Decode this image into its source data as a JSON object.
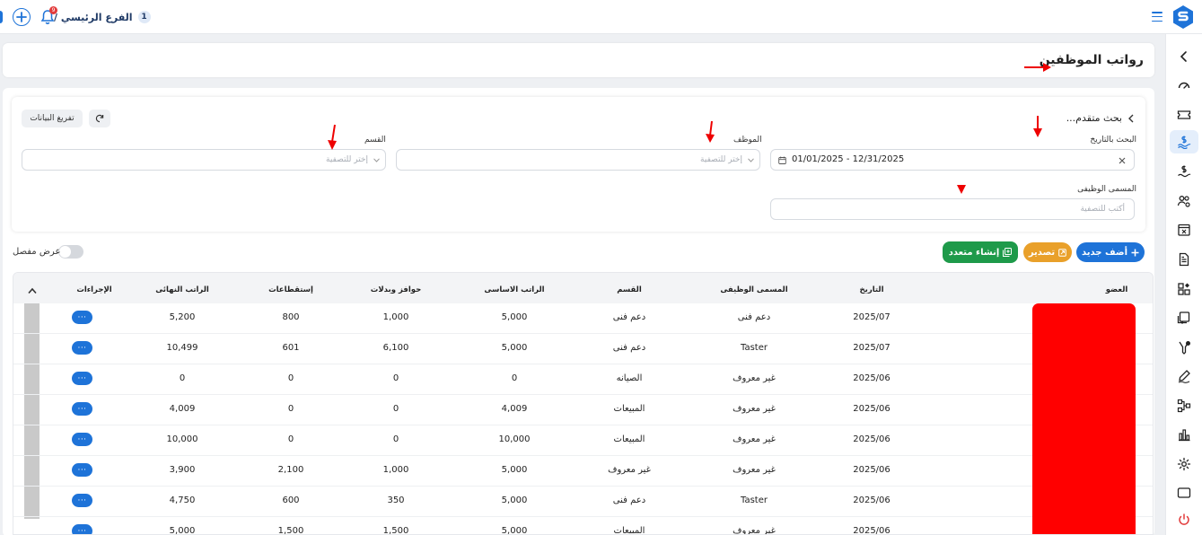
{
  "topbar": {
    "branch_label": "الفرع الرئيسي /",
    "branch_number": "1",
    "notification_count": "9"
  },
  "page": {
    "title": "رواتب الموظفين"
  },
  "filters": {
    "advanced_search_label": "بحث متقدم...",
    "clear_button": "تفريغ البيانات",
    "date_label": "البحث بالتاريخ",
    "date_value": "01/01/2025 - 12/31/2025",
    "employee_label": "الموظف",
    "employee_placeholder": "إختر للتصفية",
    "department_label": "القسم",
    "department_placeholder": "إختر للتصفية",
    "job_title_label": "المسمى الوظيفى",
    "job_title_placeholder": "أكتب للتصفية"
  },
  "actions": {
    "add_new": "أضف جديد",
    "export": "تصدير",
    "bulk_create": "إنشاء متعدد",
    "detailed_view": "عرض مفصل"
  },
  "table": {
    "columns": {
      "member": "العضو",
      "date": "التاريخ",
      "job_title": "المسمى الوظيفى",
      "department": "القسم",
      "base_salary": "الراتب الاساسى",
      "allowances": "حوافز وبدلات",
      "deductions": "إستقطاعات",
      "final_salary": "الراتب النهائى",
      "actions": "الإجراءات"
    },
    "more_label": "···",
    "rows": [
      {
        "date": "2025/07",
        "job_title": "دعم فنى",
        "department": "دعم فنى",
        "base_salary": "5,000",
        "allowances": "1,000",
        "deductions": "800",
        "final_salary": "5,200"
      },
      {
        "date": "2025/07",
        "job_title": "Taster",
        "department": "دعم فنى",
        "base_salary": "5,000",
        "allowances": "6,100",
        "deductions": "601",
        "final_salary": "10,499"
      },
      {
        "date": "2025/06",
        "job_title": "غير معروف",
        "department": "الصيانه",
        "base_salary": "0",
        "allowances": "0",
        "deductions": "0",
        "final_salary": "0"
      },
      {
        "date": "2025/06",
        "job_title": "غير معروف",
        "department": "المبيعات",
        "base_salary": "4,009",
        "allowances": "0",
        "deductions": "0",
        "final_salary": "4,009"
      },
      {
        "date": "2025/06",
        "job_title": "غير معروف",
        "department": "المبيعات",
        "base_salary": "10,000",
        "allowances": "0",
        "deductions": "0",
        "final_salary": "10,000"
      },
      {
        "date": "2025/06",
        "job_title": "غير معروف",
        "department": "غير معروف",
        "base_salary": "5,000",
        "allowances": "1,000",
        "deductions": "2,100",
        "final_salary": "3,900"
      },
      {
        "date": "2025/06",
        "job_title": "Taster",
        "department": "دعم فنى",
        "base_salary": "5,000",
        "allowances": "350",
        "deductions": "600",
        "final_salary": "4,750"
      },
      {
        "date": "2025/06",
        "job_title": "غير معروف",
        "department": "المبيعات",
        "base_salary": "5,000",
        "allowances": "1,500",
        "deductions": "1,500",
        "final_salary": "5,000"
      }
    ]
  },
  "colors": {
    "primary": "#1e73d8",
    "success": "#1e9a4a",
    "warning": "#e9a02a",
    "danger": "#e23b3b",
    "redaction": "#ff0000"
  }
}
